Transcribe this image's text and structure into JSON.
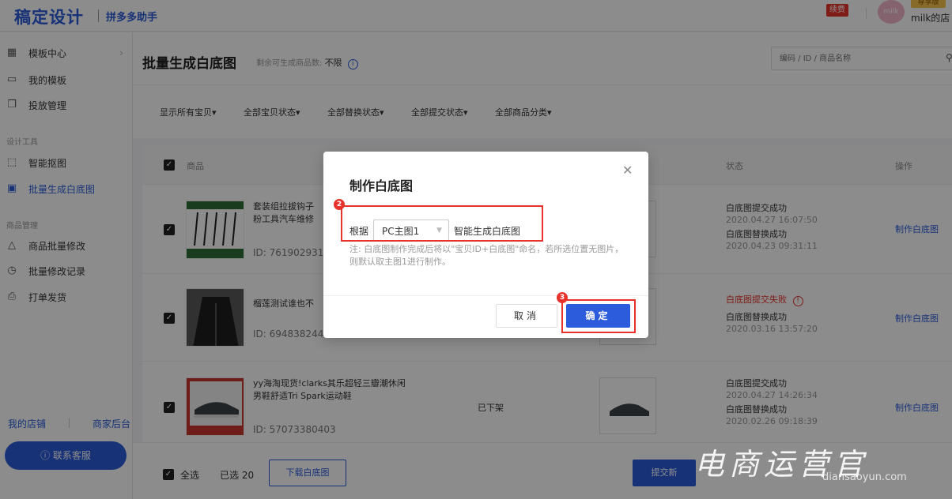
{
  "header": {
    "logo": "稿定设计",
    "subtitle": "拼多多助手",
    "renew_badge": "续费",
    "avatar_text": "milk",
    "vip_badge": "尊享版",
    "shop_name": "milk的店"
  },
  "sidebar": {
    "items_top": [
      {
        "label": "模板中心",
        "icon": "grid-icon"
      },
      {
        "label": "我的模板",
        "icon": "folder-icon"
      },
      {
        "label": "投放管理",
        "icon": "copy-icon"
      }
    ],
    "group_design": "设计工具",
    "items_design": [
      {
        "label": "智能抠图",
        "icon": "cutout-icon"
      },
      {
        "label": "批量生成白底图",
        "icon": "image-icon"
      }
    ],
    "group_goods": "商品管理",
    "items_goods": [
      {
        "label": "商品批量修改",
        "icon": "bag-icon"
      },
      {
        "label": "批量修改记录",
        "icon": "clock-icon"
      },
      {
        "label": "打单发货",
        "icon": "printer-icon"
      }
    ],
    "link_shop": "我的店铺",
    "link_merchant": "商家后台",
    "contact_button": "联系客服"
  },
  "main": {
    "title": "批量生成白底图",
    "remain_label": "剩余可生成商品数:",
    "remain_value": "不限",
    "search_placeholder": "编码 / ID / 商品名称",
    "filters": [
      "显示所有宝贝▾",
      "全部宝贝状态▾",
      "全部替换状态▾",
      "全部提交状态▾",
      "全部商品分类▾"
    ],
    "columns": {
      "product": "商品",
      "status": "状态",
      "action": "操作"
    },
    "rows": [
      {
        "name": "套装组拉拔钩子",
        "name2": "粉工具汽车维修",
        "id": "ID: 761902931",
        "status1": "白底图提交成功",
        "time1": "2020.04.27 16:07:50",
        "status2": "白底图替换成功",
        "time2": "2020.04.23 09:31:11",
        "action": "制作白底图"
      },
      {
        "name": "榴莲测试谁也不",
        "id": "ID: 6948382445",
        "status1": "白底图提交失败",
        "status2": "白底图替换成功",
        "time2": "2020.03.16 13:57:20",
        "action": "制作白底图"
      },
      {
        "name": "yy海淘现货!clarks其乐超轻三瓣潮休闲",
        "name2": "男鞋舒适Tri Spark运动鞋",
        "id": "ID: 57073380403",
        "listing_status": "已下架",
        "status1": "白底图提交成功",
        "time1": "2020.04.27 14:26:34",
        "status2": "白底图替换成功",
        "time2": "2020.02.26 09:18:39",
        "action": "制作白底图"
      }
    ],
    "footer": {
      "select_all": "全选",
      "selected": "已选 20",
      "download": "下载白底图",
      "submit": "提交新"
    }
  },
  "modal": {
    "title": "制作白底图",
    "prefix": "根据",
    "select_value": "PC主图1",
    "suffix": "智能生成白底图",
    "note": "注: 白底图制作完成后将以\"宝贝ID+白底图\"命名，若所选位置无图片，则默认取主图1进行制作。",
    "cancel": "取消",
    "confirm": "确定",
    "step2": "2",
    "step3": "3"
  },
  "watermark": {
    "text": "电商运营官",
    "sub": "diansaoyun.com"
  },
  "colors": {
    "brand": "#2c5cdb",
    "highlight": "#e8332d"
  }
}
